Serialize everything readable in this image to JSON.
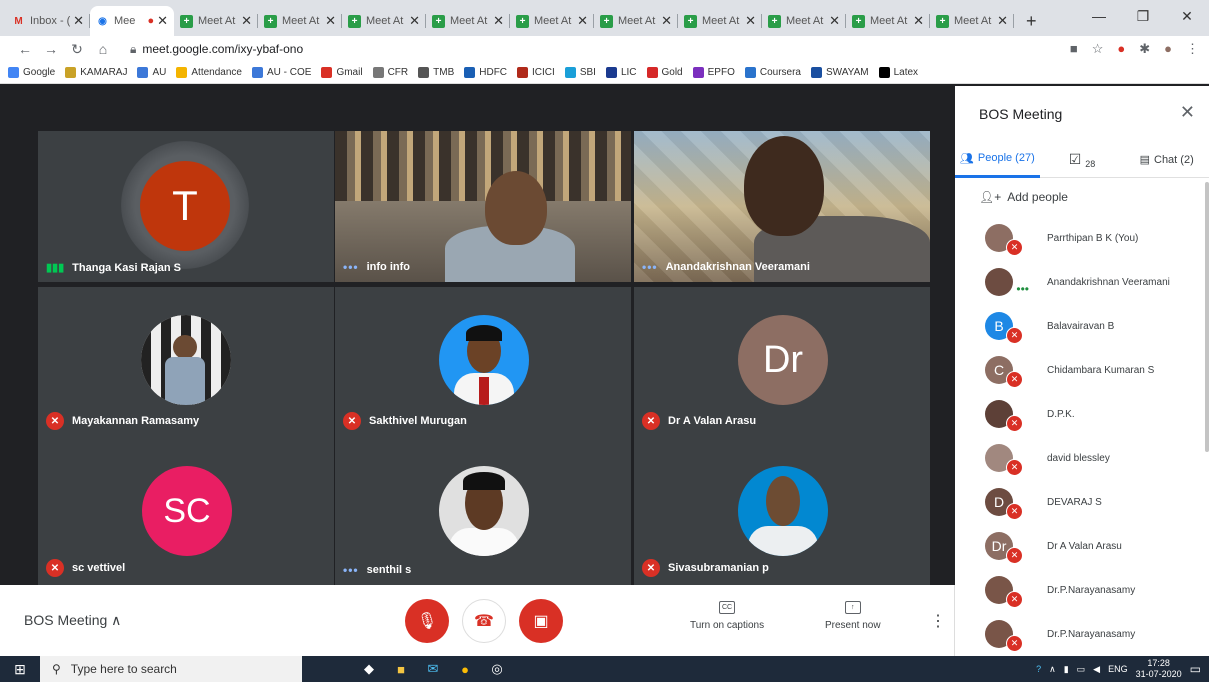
{
  "browser": {
    "tabs": [
      {
        "label": "Inbox - (",
        "icon": "gmail-icon",
        "active": false
      },
      {
        "label": "Mee",
        "icon": "meet-icon",
        "active": true
      },
      {
        "label": "Meet At",
        "icon": "meet-icon",
        "active": false
      },
      {
        "label": "Meet At",
        "icon": "meet-icon",
        "active": false
      },
      {
        "label": "Meet At",
        "icon": "meet-icon",
        "active": false
      },
      {
        "label": "Meet At",
        "icon": "meet-icon",
        "active": false
      },
      {
        "label": "Meet At",
        "icon": "meet-icon",
        "active": false
      },
      {
        "label": "Meet At",
        "icon": "meet-icon",
        "active": false
      },
      {
        "label": "Meet At",
        "icon": "meet-icon",
        "active": false
      },
      {
        "label": "Meet At",
        "icon": "meet-icon",
        "active": false
      },
      {
        "label": "Meet At",
        "icon": "meet-icon",
        "active": false
      },
      {
        "label": "Meet At",
        "icon": "meet-icon",
        "active": false
      }
    ],
    "url": "meet.google.com/ixy-ybaf-ono",
    "bookmarks": [
      {
        "label": "Google",
        "color": "#4285f4"
      },
      {
        "label": "KAMARAJ",
        "color": "#c9a227"
      },
      {
        "label": "AU",
        "color": "#3c78d8"
      },
      {
        "label": "Attendance",
        "color": "#f4b400"
      },
      {
        "label": "AU - COE",
        "color": "#3c78d8"
      },
      {
        "label": "Gmail",
        "color": "#d93025"
      },
      {
        "label": "CFR",
        "color": "#777777"
      },
      {
        "label": "TMB",
        "color": "#555555"
      },
      {
        "label": "HDFC",
        "color": "#1a5fb4"
      },
      {
        "label": "ICICI",
        "color": "#b02a1a"
      },
      {
        "label": "SBI",
        "color": "#1a9fd8"
      },
      {
        "label": "LIC",
        "color": "#1b3a8f"
      },
      {
        "label": "Gold",
        "color": "#d62828"
      },
      {
        "label": "EPFO",
        "color": "#7b2fbe"
      },
      {
        "label": "Coursera",
        "color": "#2a73cc"
      },
      {
        "label": "SWAYAM",
        "color": "#1a4fa0"
      },
      {
        "label": "Latex",
        "color": "#000000"
      }
    ]
  },
  "grid": {
    "tiles": [
      {
        "name": "Thanga Kasi Rajan S",
        "kind": "avatar",
        "initials": "T",
        "color": "#bf360c",
        "status": "speaking"
      },
      {
        "name": "info info",
        "kind": "video",
        "status": "dots"
      },
      {
        "name": "Anandakrishnan Veeramani",
        "kind": "video",
        "status": "dots"
      },
      {
        "name": "Mayakannan Ramasamy",
        "kind": "photo",
        "status": "muted"
      },
      {
        "name": "Sakthivel Murugan",
        "kind": "photo",
        "status": "muted"
      },
      {
        "name": "Dr A Valan Arasu",
        "kind": "avatar",
        "initials": "Dr",
        "color": "#8d6e63",
        "status": "muted"
      },
      {
        "name": "sc vettivel",
        "kind": "avatar",
        "initials": "SC",
        "color": "#e91e63",
        "status": "muted"
      },
      {
        "name": "senthil s",
        "kind": "photo",
        "status": "dots"
      },
      {
        "name": "Sivasubramanian p",
        "kind": "photo",
        "status": "muted"
      }
    ]
  },
  "bottom": {
    "meeting_title": "BOS Meeting",
    "captions_label": "Turn on captions",
    "present_label": "Present now"
  },
  "panel": {
    "title": "BOS Meeting",
    "people_tab": "People (27)",
    "tasks_count": "28",
    "chat_tab": "Chat (2)",
    "add_people": "Add people",
    "people": [
      {
        "name": "Parrthipan B K (You)",
        "initial": "",
        "color": "#8d6e63",
        "status": "muted"
      },
      {
        "name": "Anandakrishnan Veeramani",
        "initial": "",
        "color": "#6d4c41",
        "status": "dots"
      },
      {
        "name": "Balavairavan B",
        "initial": "B",
        "color": "#1e88e5",
        "status": "muted"
      },
      {
        "name": "Chidambara Kumaran S",
        "initial": "C",
        "color": "#8d6e63",
        "status": "muted"
      },
      {
        "name": "D.P.K.",
        "initial": "",
        "color": "#5d4037",
        "status": "muted"
      },
      {
        "name": "david blessley",
        "initial": "",
        "color": "#a1887f",
        "status": "muted"
      },
      {
        "name": "DEVARAJ S",
        "initial": "D",
        "color": "#6d4c41",
        "status": "muted"
      },
      {
        "name": "Dr A Valan Arasu",
        "initial": "Dr",
        "color": "#8d6e63",
        "status": "muted"
      },
      {
        "name": "Dr.P.Narayanasamy",
        "initial": "",
        "color": "#795548",
        "status": "muted"
      },
      {
        "name": "Dr.P.Narayanasamy",
        "initial": "",
        "color": "#795548",
        "status": "muted"
      }
    ]
  },
  "taskbar": {
    "search_placeholder": "Type here to search",
    "lang": "ENG",
    "time": "17:28",
    "date": "31-07-2020"
  }
}
